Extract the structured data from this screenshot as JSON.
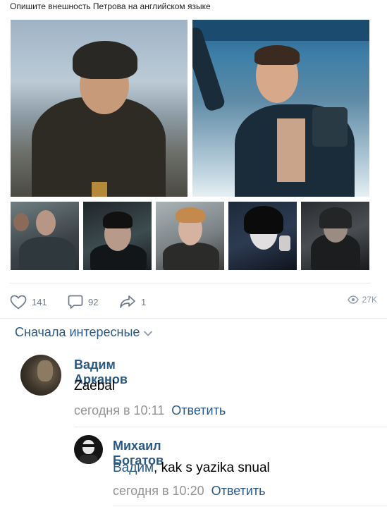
{
  "post": {
    "caption": "Опишите внешность Петрова на английском языке",
    "stats": {
      "likes": "141",
      "comments": "92",
      "shares": "1",
      "views": "27K"
    }
  },
  "comments_section": {
    "sort_label": "Сначала интересные"
  },
  "comments": [
    {
      "author": "Вадим Арканов",
      "text": "Zaebal",
      "time": "сегодня в 10:11",
      "reply_label": "Ответить"
    },
    {
      "author": "Михаил Богатов",
      "mention": "Вадим",
      "text": ", kak s yazika snual",
      "time": "сегодня в 10:20",
      "reply_label": "Ответить"
    }
  ],
  "colors": {
    "link": "#2a5885",
    "muted": "#939393",
    "icon": "#6c7a8a"
  }
}
